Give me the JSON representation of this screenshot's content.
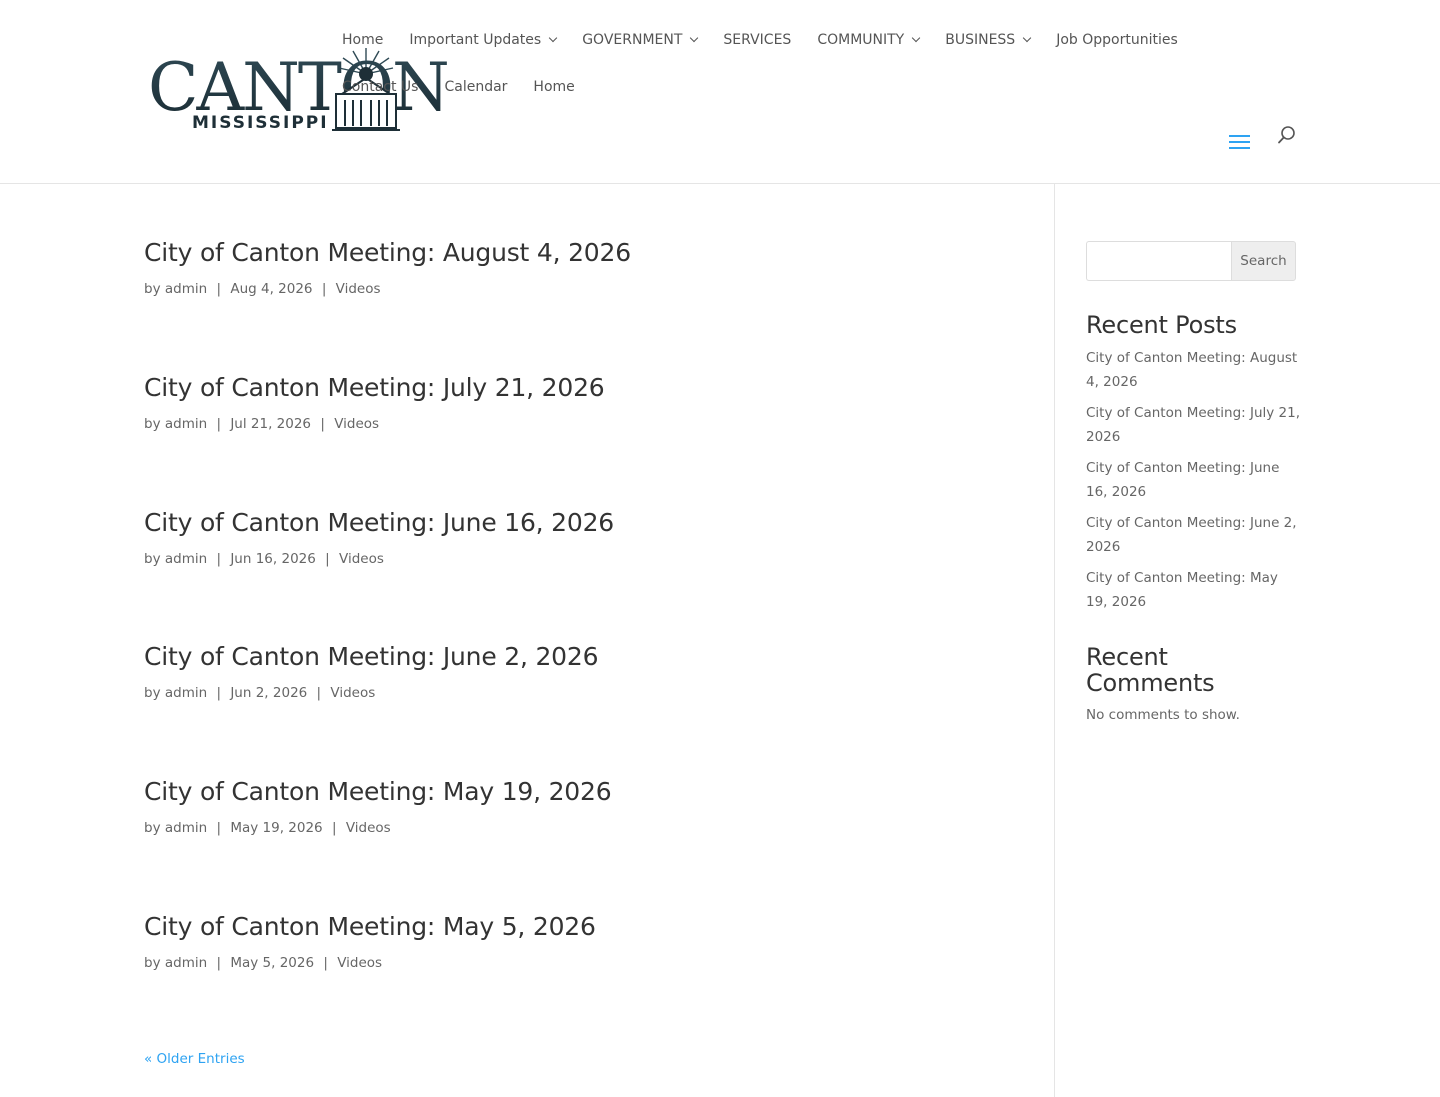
{
  "header": {
    "logo": {
      "wordmark": "CANTON",
      "subtitle": "MISSISSIPPI"
    },
    "nav_primary": [
      {
        "label": "Home",
        "has_dropdown": false
      },
      {
        "label": "Important Updates",
        "has_dropdown": true
      },
      {
        "label": "GOVERNMENT",
        "has_dropdown": true
      },
      {
        "label": "SERVICES",
        "has_dropdown": false
      },
      {
        "label": "COMMUNITY",
        "has_dropdown": true
      },
      {
        "label": "BUSINESS",
        "has_dropdown": true
      },
      {
        "label": "Job Opportunities",
        "has_dropdown": false
      }
    ],
    "nav_secondary": [
      {
        "label": "Contact Us"
      },
      {
        "label": "Calendar"
      },
      {
        "label": "Home"
      }
    ],
    "icons": {
      "menu": "hamburger-menu-icon",
      "search": "search-icon"
    },
    "accent_color": "#2ea3f2"
  },
  "posts": [
    {
      "title": "City of Canton Meeting: August 4, 2026",
      "author": "admin",
      "date": "Aug 4, 2026",
      "category": "Videos"
    },
    {
      "title": "City of Canton Meeting: July 21, 2026",
      "author": "admin",
      "date": "Jul 21, 2026",
      "category": "Videos"
    },
    {
      "title": "City of Canton Meeting: June 16, 2026",
      "author": "admin",
      "date": "Jun 16, 2026",
      "category": "Videos"
    },
    {
      "title": "City of Canton Meeting: June 2, 2026",
      "author": "admin",
      "date": "Jun 2, 2026",
      "category": "Videos"
    },
    {
      "title": "City of Canton Meeting: May 19, 2026",
      "author": "admin",
      "date": "May 19, 2026",
      "category": "Videos"
    },
    {
      "title": "City of Canton Meeting: May 5, 2026",
      "author": "admin",
      "date": "May 5, 2026",
      "category": "Videos"
    }
  ],
  "meta_by": "by",
  "meta_sep": "|",
  "pagination": {
    "older_label": "« Older Entries"
  },
  "sidebar": {
    "search": {
      "placeholder": "",
      "value": "",
      "button_label": "Search"
    },
    "recent_posts_title": "Recent Posts",
    "recent_posts": [
      "City of Canton Meeting: August 4, 2026",
      "City of Canton Meeting: July 21, 2026",
      "City of Canton Meeting: June 16, 2026",
      "City of Canton Meeting: June 2, 2026",
      "City of Canton Meeting: May 19, 2026"
    ],
    "recent_comments_title": "Recent Comments",
    "recent_comments_empty": "No comments to show."
  }
}
